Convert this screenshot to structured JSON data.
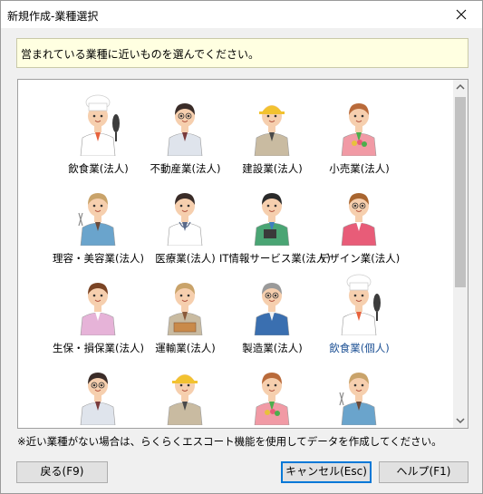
{
  "window": {
    "title": "新規作成-業種選択",
    "close_icon": "close-icon"
  },
  "info": {
    "text": "営まれている業種に近いものを選んでください。"
  },
  "industries": [
    {
      "label": "飲食業(法人)",
      "icon": "chef-with-pan-icon",
      "hair": "#ffffff",
      "shirt": "#ffffff",
      "skin": "#f6cfae",
      "accent": "#e8623c",
      "prop": "pan",
      "selected": false
    },
    {
      "label": "不動産業(法人)",
      "icon": "realtor-with-glasses-icon",
      "hair": "#3a2c28",
      "shirt": "#dfe4ec",
      "skin": "#f6cfae",
      "accent": "#7a3b3b",
      "prop": "glasses",
      "selected": false
    },
    {
      "label": "建設業(法人)",
      "icon": "construction-worker-helmet-icon",
      "hair": "#f2c230",
      "shirt": "#c9bba1",
      "skin": "#f6cfae",
      "accent": "#4a4a4a",
      "prop": "helmet",
      "selected": false
    },
    {
      "label": "小売業(法人)",
      "icon": "retail-clerk-with-flowers-icon",
      "hair": "#b96a3a",
      "shirt": "#f19aa5",
      "skin": "#f6cfae",
      "accent": "#4cae4c",
      "prop": "flowers",
      "selected": false
    },
    {
      "label": "理容・美容業(法人)",
      "icon": "hairdresser-with-scissors-icon",
      "hair": "#c9a36a",
      "shirt": "#6aa4cc",
      "skin": "#f6cfae",
      "accent": "#6a4a3a",
      "prop": "scissors",
      "selected": false
    },
    {
      "label": "医療業(法人)",
      "icon": "doctor-with-stethoscope-icon",
      "hair": "#3a2c28",
      "shirt": "#ffffff",
      "skin": "#f6cfae",
      "accent": "#5a6a8a",
      "prop": "stethoscope",
      "selected": false
    },
    {
      "label": "IT情報サービス業(法人)",
      "icon": "it-worker-with-tablet-icon",
      "hair": "#2a2a2a",
      "shirt": "#4aa574",
      "skin": "#f6cfae",
      "accent": "#3f7fbf",
      "prop": "tablet",
      "selected": false
    },
    {
      "label": "デザイン業(法人)",
      "icon": "designer-woman-glasses-icon",
      "hair": "#a8652f",
      "shirt": "#e85c78",
      "skin": "#f6cfae",
      "accent": "#ffffff",
      "prop": "glasses",
      "selected": false
    },
    {
      "label": "生保・損保業(法人)",
      "icon": "insurance-agent-woman-icon",
      "hair": "#7a4424",
      "shirt": "#e6b3d8",
      "skin": "#f6cfae",
      "accent": "#ffffff",
      "prop": "none",
      "selected": false
    },
    {
      "label": "運輸業(法人)",
      "icon": "delivery-worker-with-boxes-icon",
      "hair": "#c9a36a",
      "shirt": "#c9bba1",
      "skin": "#f6cfae",
      "accent": "#8a5a3a",
      "prop": "box",
      "selected": false
    },
    {
      "label": "製造業(法人)",
      "icon": "factory-worker-blue-uniform-icon",
      "hair": "#9a9a9a",
      "shirt": "#3a6fb0",
      "skin": "#f6cfae",
      "accent": "#f2f2f2",
      "prop": "glasses",
      "selected": false
    },
    {
      "label": "飲食業(個人)",
      "icon": "chef-with-pan-icon",
      "hair": "#ffffff",
      "shirt": "#ffffff",
      "skin": "#f6cfae",
      "accent": "#e8623c",
      "prop": "pan",
      "selected": true
    },
    {
      "label": "",
      "icon": "realtor-with-glasses-icon",
      "hair": "#3a2c28",
      "shirt": "#dfe4ec",
      "skin": "#f6cfae",
      "accent": "#7a3b3b",
      "prop": "glasses",
      "selected": false
    },
    {
      "label": "",
      "icon": "construction-worker-helmet-icon",
      "hair": "#f2c230",
      "shirt": "#c9bba1",
      "skin": "#f6cfae",
      "accent": "#4a4a4a",
      "prop": "helmet",
      "selected": false
    },
    {
      "label": "",
      "icon": "retail-clerk-with-flowers-icon",
      "hair": "#b96a3a",
      "shirt": "#f19aa5",
      "skin": "#f6cfae",
      "accent": "#4cae4c",
      "prop": "flowers",
      "selected": false
    },
    {
      "label": "",
      "icon": "hairdresser-with-scissors-icon",
      "hair": "#c9a36a",
      "shirt": "#6aa4cc",
      "skin": "#f6cfae",
      "accent": "#6a4a3a",
      "prop": "scissors",
      "selected": false
    }
  ],
  "note": "※近い業種がない場合は、らくらくエスコート機能を使用してデータを作成してください。",
  "buttons": {
    "back": "戻る(F9)",
    "cancel": "キャンセル(Esc)",
    "help": "ヘルプ(F1)"
  }
}
